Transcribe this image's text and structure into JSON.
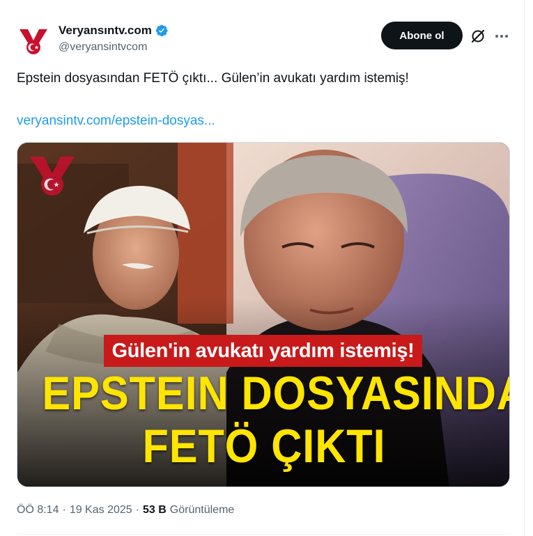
{
  "account": {
    "name": "Veryansıntv.com",
    "handle": "@veryansintvcom",
    "verified": true,
    "logo_icon": "veryansin-medal-logo"
  },
  "actions": {
    "follow_label": "Abone ol",
    "grok_icon": "grok-slash-circle-icon",
    "more_icon": "more-dots-icon"
  },
  "tweet": {
    "text": "Epstein dosyasından FETÖ çıktı... Gülen’in avukatı yardım istemiş!",
    "link": "veryansintv.com/epstein-dosyas..."
  },
  "media": {
    "caption": "Gülen'in avukatı yardım istemiş!",
    "headline_line1": "EPSTEIN DOSYASINDAN",
    "headline_line2": "FETÖ ÇIKTI",
    "headline_color": "#ffe500",
    "caption_bg": "#c81a1a"
  },
  "meta": {
    "time": "ÖÖ 8:14",
    "separator": "·",
    "date": "19 Kas 2025",
    "views_count": "53 B",
    "views_label": "Görüntüleme"
  },
  "colors": {
    "link": "#1d9bf0",
    "secondary": "#536471",
    "primary": "#0f1419"
  }
}
